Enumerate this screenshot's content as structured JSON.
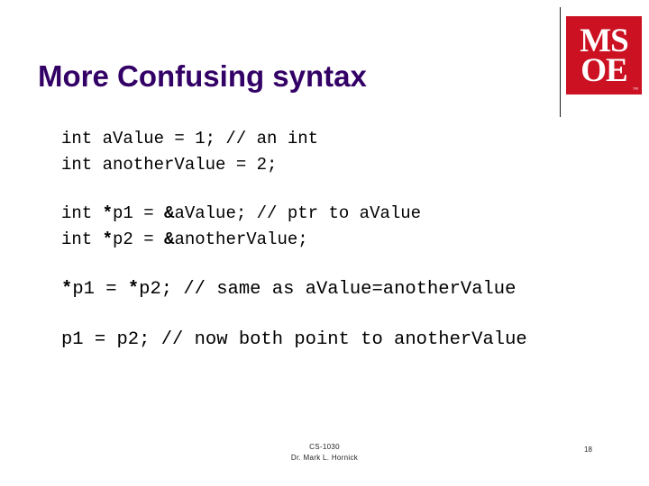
{
  "slide": {
    "title": "More Confusing syntax",
    "title_color": "#330066",
    "background_color": "#ffffff"
  },
  "logo": {
    "name": "MSOE",
    "line1": "MS",
    "line2": "OE",
    "trademark": "™",
    "background_color": "#cc1122",
    "text_color": "#ffffff"
  },
  "code": {
    "groups": [
      {
        "lines": [
          [
            {
              "text": "int aValue = 1; // an int",
              "bold": false
            }
          ],
          [
            {
              "text": "int anotherValue = 2;",
              "bold": false
            }
          ]
        ]
      },
      {
        "lines": [
          [
            {
              "text": "int ",
              "bold": false
            },
            {
              "text": "*",
              "bold": true
            },
            {
              "text": "p1 = ",
              "bold": false
            },
            {
              "text": "&",
              "bold": true
            },
            {
              "text": "aValue; // ptr to aValue",
              "bold": false
            }
          ],
          [
            {
              "text": "int ",
              "bold": false
            },
            {
              "text": "*",
              "bold": true
            },
            {
              "text": "p2 = ",
              "bold": false
            },
            {
              "text": "&",
              "bold": true
            },
            {
              "text": "anotherValue;",
              "bold": false
            }
          ]
        ]
      },
      {
        "lines": [
          [
            {
              "text": "*",
              "bold": true
            },
            {
              "text": "p1 = ",
              "bold": false
            },
            {
              "text": "*",
              "bold": true
            },
            {
              "text": "p2; // same as aValue=anotherValue",
              "bold": false
            }
          ]
        ]
      },
      {
        "lines": [
          [
            {
              "text": "p1 = p2; // now both point to anotherValue",
              "bold": false
            }
          ]
        ]
      }
    ]
  },
  "footer": {
    "course": "CS-1030",
    "instructor": "Dr. Mark L. Hornick",
    "page_number": "18"
  }
}
